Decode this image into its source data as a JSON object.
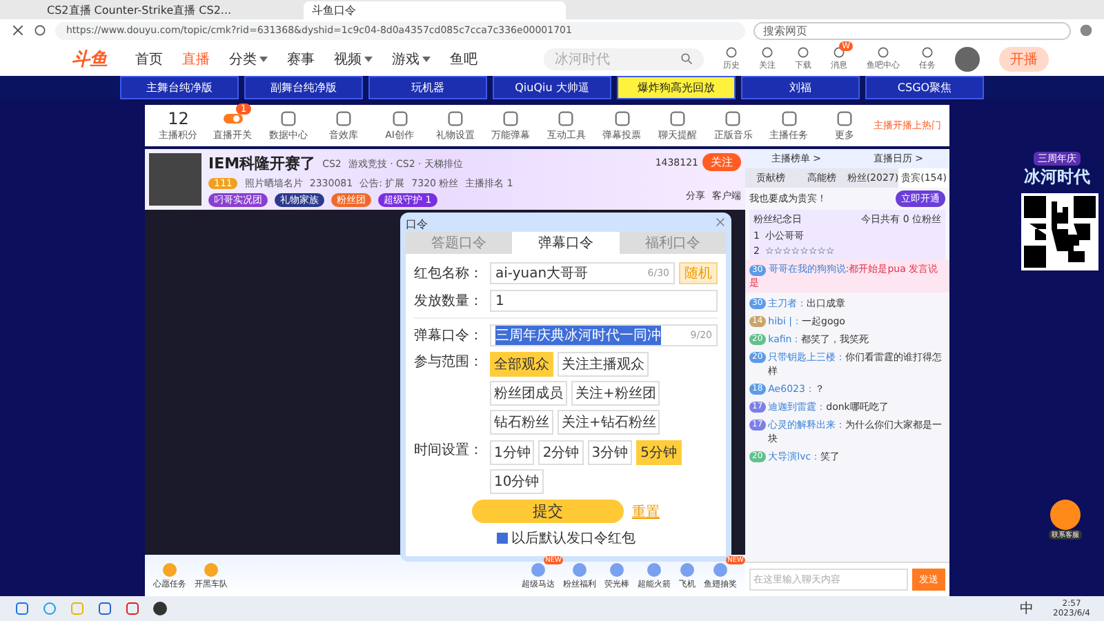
{
  "browser": {
    "tabs": [
      {
        "title": "CS2直播 Counter-Strike直播 CS2...",
        "selected": false
      },
      {
        "title": "斗鱼口令",
        "selected": true
      }
    ],
    "url": "https://www.douyu.com/topic/cmk?rid=631368&dyshid=1c9c04-8d0a4357cd085c7cca7c336e00001701",
    "search_placeholder": "搜索网页"
  },
  "site_nav": {
    "logo": "斗鱼",
    "items": [
      {
        "label": "首页",
        "selected": false,
        "dropdown": false
      },
      {
        "label": "直播",
        "selected": true,
        "dropdown": false
      },
      {
        "label": "分类",
        "selected": false,
        "dropdown": true
      },
      {
        "label": "赛事",
        "selected": false,
        "dropdown": false
      },
      {
        "label": "视频",
        "selected": false,
        "dropdown": true
      },
      {
        "label": "游戏",
        "selected": false,
        "dropdown": true
      },
      {
        "label": "鱼吧",
        "selected": false,
        "dropdown": false
      }
    ],
    "search_placeholder": "冰河时代",
    "icons": [
      {
        "label": "历史"
      },
      {
        "label": "关注"
      },
      {
        "label": "下载"
      },
      {
        "label": "消息",
        "badge": "W"
      },
      {
        "label": "鱼吧中心"
      },
      {
        "label": "任务"
      }
    ],
    "live_button": "开播"
  },
  "stage_tabs": [
    {
      "label": "主舞台纯净版",
      "selected": false
    },
    {
      "label": "副舞台纯净版",
      "selected": false
    },
    {
      "label": "玩机器",
      "selected": false
    },
    {
      "label": "QiuQiu 大帅逼",
      "selected": false
    },
    {
      "label": "爆炸狗高光回放",
      "selected": true
    },
    {
      "label": "刘福",
      "selected": false
    },
    {
      "label": "CSGO聚焦",
      "selected": false
    }
  ],
  "anchor_tools": {
    "score": "12",
    "score_label": "主播积分",
    "items": [
      {
        "kind": "toggle",
        "label": "直播开关",
        "badge": "1"
      },
      {
        "kind": "tool",
        "label": "数据中心"
      },
      {
        "kind": "tool",
        "label": "音效库"
      },
      {
        "kind": "tool",
        "label": "AI创作"
      },
      {
        "kind": "tool",
        "label": "礼物设置"
      },
      {
        "kind": "tool",
        "label": "万能弹幕"
      },
      {
        "kind": "tool",
        "label": "互动工具"
      },
      {
        "kind": "tool",
        "label": "弹幕投票"
      },
      {
        "kind": "tool",
        "label": "聊天提醒"
      },
      {
        "kind": "tool",
        "label": "正版音乐"
      },
      {
        "kind": "tool",
        "label": "主播任务"
      },
      {
        "kind": "tool",
        "label": "更多"
      }
    ],
    "promo": "主播开播上热门"
  },
  "room": {
    "title": "IEM科隆开赛了",
    "category_tag": "CS2",
    "breadcrumb": "游戏竞技 · CS2 · 天梯排位",
    "level": "111",
    "anchor_name": "照片晒墙名片",
    "hot": "2330081",
    "notice": "公告: 扩展",
    "fans": "7320 粉丝",
    "rank": "主播排名 1",
    "tags": [
      {
        "label": "叼哥实况团",
        "color": "#8a3fd1"
      },
      {
        "label": "礼物家族",
        "color": "#2b3a8c"
      },
      {
        "label": "粉丝团",
        "color": "#f06a2c"
      },
      {
        "label": "超级守护 1",
        "color": "#7a2fe0"
      }
    ],
    "follow_count": "1438121",
    "follow_button": "关注",
    "share": "分享",
    "client": "客户端"
  },
  "password_dialog": {
    "title": "口令",
    "tabs": [
      {
        "label": "答题口令",
        "selected": false
      },
      {
        "label": "弹幕口令",
        "selected": true
      },
      {
        "label": "福利口令",
        "selected": false
      }
    ],
    "name_label": "红包名称：",
    "name_value": "ai-yuan大哥哥",
    "name_count": "6/30",
    "random_button": "随机",
    "quantity_label": "发放数量：",
    "quantity_value": "1",
    "password_label": "弹幕口令：",
    "password_value": "三周年庆典冰河时代一同冲",
    "password_count": "9/20",
    "scope_label": "参与范围：",
    "scopes": [
      {
        "label": "全部观众",
        "selected": true
      },
      {
        "label": "关注主播观众",
        "selected": false
      },
      {
        "label": "粉丝团成员",
        "selected": false
      },
      {
        "label": "关注+粉丝团",
        "selected": false
      },
      {
        "label": "钻石粉丝",
        "selected": false
      },
      {
        "label": "关注+钻石粉丝",
        "selected": false
      }
    ],
    "time_label": "时间设置：",
    "times": [
      {
        "label": "1分钟",
        "selected": false
      },
      {
        "label": "2分钟",
        "selected": false
      },
      {
        "label": "3分钟",
        "selected": false
      },
      {
        "label": "5分钟",
        "selected": true
      },
      {
        "label": "10分钟",
        "selected": false
      }
    ],
    "submit": "提交",
    "reset": "重置",
    "default_option": {
      "label": "以后默认发口令红包",
      "checked": true
    }
  },
  "gift_bar": {
    "left": [
      "心愿任务",
      "开黑车队"
    ],
    "gifts": [
      {
        "label": "超级马达",
        "badge": "NEW"
      },
      {
        "label": "粉丝福利"
      },
      {
        "label": "荧光棒"
      },
      {
        "label": "超能火箭"
      },
      {
        "label": "飞机"
      },
      {
        "label": "鱼翅抽奖",
        "badge": "NEW"
      }
    ]
  },
  "chat": {
    "rank_links": [
      "主播榜单 >",
      "直播日历 >"
    ],
    "tabs": [
      {
        "label": "贡献榜",
        "selected": false
      },
      {
        "label": "高能榜",
        "selected": false
      },
      {
        "label": "粉丝(2027)",
        "selected": false
      },
      {
        "label": "贵宾(154)",
        "selected": true
      }
    ],
    "vip_prompt": "我也要成为贵宾！",
    "vip_button": "立即开通",
    "fan_card": {
      "title": "粉丝纪念日",
      "note": "今日共有 0 位粉丝",
      "rows": [
        {
          "rank": "1",
          "name": "小公哥哥"
        },
        {
          "rank": "2",
          "name": "☆☆☆☆☆☆☆☆"
        }
      ]
    },
    "pinned": {
      "level": "30",
      "user": "哥哥在我的狗狗说:",
      "text": "都开始是pua 发言说是"
    },
    "messages": [
      {
        "level": "30",
        "color": "#5b9bea",
        "user": "主刀者：",
        "text": "出口成章"
      },
      {
        "level": "14",
        "color": "#c9a46a",
        "user": "hibi |：",
        "text": "一起gogo"
      },
      {
        "level": "20",
        "color": "#5fc28a",
        "user": "kafin：",
        "text": "都笑了，我笑死"
      },
      {
        "level": "20",
        "color": "#5b9bea",
        "user": "只带钥匙上三楼：",
        "text": "你们看雷霆的谁打得怎样"
      },
      {
        "level": "18",
        "color": "#5b9bea",
        "user": "Ae6023：",
        "text": "？"
      },
      {
        "level": "17",
        "color": "#7c7fe8",
        "user": "迪迦到雷霆：",
        "text": "donk哪吒吃了"
      },
      {
        "level": "17",
        "color": "#7c7fe8",
        "user": "心灵的解释出来：",
        "text": "为什么你们大家都是一块"
      },
      {
        "level": "20",
        "color": "#5fc28a",
        "user": "大导演lvc：",
        "text": "笑了"
      }
    ],
    "input_placeholder": "在这里输入聊天内容",
    "send": "发送"
  },
  "side": {
    "brand": "冰河时代",
    "brand_tag": "三周年庆",
    "support": "联系客服"
  },
  "taskbar": {
    "ime": "中",
    "time": "2:57",
    "date": "2023/6/4"
  }
}
